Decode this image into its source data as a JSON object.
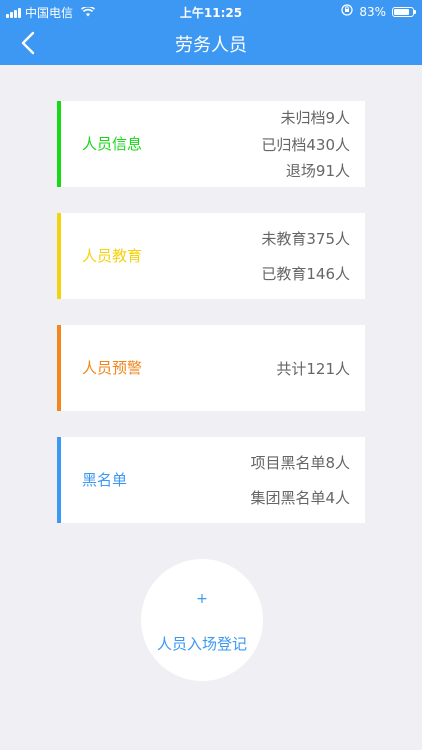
{
  "status_bar": {
    "carrier": "中国电信",
    "time": "上午11:25",
    "battery": "83%",
    "battery_level": 0.83
  },
  "header": {
    "title": "劳务人员",
    "back_icon": "chevron-left-icon"
  },
  "cards": [
    {
      "title": "人员信息",
      "color": "#19d819",
      "stats": [
        "未归档9人",
        "已归档430人",
        "退场91人"
      ]
    },
    {
      "title": "人员教育",
      "color": "#f5d20f",
      "stats": [
        "未教育375人",
        "已教育146人"
      ]
    },
    {
      "title": "人员预警",
      "color": "#f2851c",
      "stats": [
        "共计121人"
      ]
    },
    {
      "title": "黑名单",
      "color": "#3c98f2",
      "stats": [
        "项目黑名单8人",
        "集团黑名单4人"
      ]
    }
  ],
  "register": {
    "plus": "+",
    "label": "人员入场登记"
  }
}
